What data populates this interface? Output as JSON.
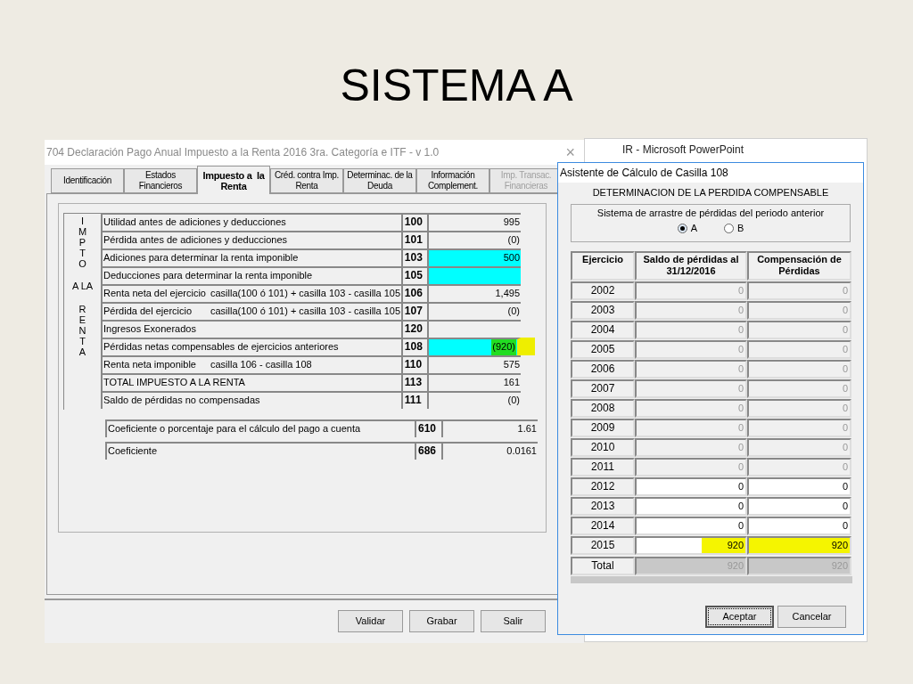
{
  "slide": {
    "title": "SISTEMA A"
  },
  "background_window": {
    "title": "IR - Microsoft PowerPoint"
  },
  "main_window": {
    "title": "704 Declaración Pago Anual Impuesto a la Renta 2016 3ra. Categoría e ITF - v 1.0",
    "close": "×",
    "tabs": [
      {
        "label": "Identificación",
        "selected": false,
        "disabled": false
      },
      {
        "label": "Estados\nFinancieros",
        "selected": false,
        "disabled": false
      },
      {
        "label": "Impuesto a  la\nRenta",
        "selected": true,
        "disabled": false
      },
      {
        "label": "Créd. contra Imp.\nRenta",
        "selected": false,
        "disabled": false
      },
      {
        "label": "Determinac. de la\nDeuda",
        "selected": false,
        "disabled": false
      },
      {
        "label": "Información\nComplement.",
        "selected": false,
        "disabled": false
      },
      {
        "label": "Imp. Transac.\nFinancieras",
        "selected": false,
        "disabled": true
      }
    ],
    "side_label": [
      "IMPTO",
      "A LA",
      "RENTA"
    ],
    "rows": [
      {
        "label": "Utilidad antes de adiciones y deducciones",
        "code": "100",
        "value": "995",
        "kind": "calc",
        "highlighted": false
      },
      {
        "label": "Pérdida antes de adiciones y deducciones",
        "code": "101",
        "value": "(0)",
        "kind": "calc",
        "highlighted": false
      },
      {
        "label": "Adiciones para determinar la renta imponible",
        "code": "103",
        "value": "500",
        "kind": "input",
        "highlighted": false
      },
      {
        "label": "Deducciones para determinar la renta imponible",
        "code": "105",
        "kind": "input",
        "highlighted": false
      },
      {
        "label": "Renta neta del ejercicio",
        "formula": "casilla(100 ó 101) + casilla 103 - casilla 105",
        "code": "106",
        "value": "1,495",
        "kind": "calc",
        "highlighted": false
      },
      {
        "label": "Pérdida del ejercicio",
        "formula": "casilla(100 ó 101) + casilla 103 - casilla 105",
        "code": "107",
        "value": "(0)",
        "kind": "calc",
        "highlighted": false
      },
      {
        "label": "Ingresos Exonerados",
        "code": "120",
        "kind": "calc",
        "highlighted": false
      },
      {
        "label": "Pérdidas netas compensables de ejercicios anteriores",
        "code": "108",
        "value": "(920)",
        "kind": "input",
        "highlighted": true
      },
      {
        "label": "Renta neta imponible",
        "formula": "casilla 106 - casilla 108",
        "code": "110",
        "value": "575",
        "kind": "calc",
        "highlighted": false
      },
      {
        "label": "TOTAL IMPUESTO A LA RENTA",
        "code": "113",
        "value": "161",
        "kind": "calc",
        "highlighted": false
      },
      {
        "label": "Saldo de pérdidas no compensadas",
        "code": "111",
        "value": "(0)",
        "kind": "calc",
        "highlighted": false
      }
    ],
    "extra_rows": [
      {
        "label": "Coeficiente o porcentaje para el cálculo del pago a cuenta",
        "code": "610",
        "value": "1.61"
      },
      {
        "label": "Coeficiente",
        "code": "686",
        "value": "0.0161"
      }
    ],
    "buttons": [
      "Validar",
      "Grabar",
      "Salir"
    ]
  },
  "dialog": {
    "title": "Asistente de Cálculo de Casilla 108",
    "heading": "DETERMINACION DE LA PERDIDA COMPENSABLE",
    "group_label": "Sistema de arrastre de pérdidas del periodo anterior",
    "options": [
      {
        "label": "A",
        "selected": true
      },
      {
        "label": "B",
        "selected": false
      }
    ],
    "columns": [
      "Ejercicio",
      "Saldo de pérdidas  al\n31/12/2016",
      "Compensación de\nPérdidas"
    ],
    "rows": [
      {
        "year": "2002",
        "balance": "0",
        "compensation": "0",
        "editable": false,
        "highlighted": false
      },
      {
        "year": "2003",
        "balance": "0",
        "compensation": "0",
        "editable": false,
        "highlighted": false
      },
      {
        "year": "2004",
        "balance": "0",
        "compensation": "0",
        "editable": false,
        "highlighted": false
      },
      {
        "year": "2005",
        "balance": "0",
        "compensation": "0",
        "editable": false,
        "highlighted": false
      },
      {
        "year": "2006",
        "balance": "0",
        "compensation": "0",
        "editable": false,
        "highlighted": false
      },
      {
        "year": "2007",
        "balance": "0",
        "compensation": "0",
        "editable": false,
        "highlighted": false
      },
      {
        "year": "2008",
        "balance": "0",
        "compensation": "0",
        "editable": false,
        "highlighted": false
      },
      {
        "year": "2009",
        "balance": "0",
        "compensation": "0",
        "editable": false,
        "highlighted": false
      },
      {
        "year": "2010",
        "balance": "0",
        "compensation": "0",
        "editable": false,
        "highlighted": false
      },
      {
        "year": "2011",
        "balance": "0",
        "compensation": "0",
        "editable": false,
        "highlighted": false
      },
      {
        "year": "2012",
        "balance": "0",
        "compensation": "0",
        "editable": true,
        "highlighted": false
      },
      {
        "year": "2013",
        "balance": "0",
        "compensation": "0",
        "editable": true,
        "highlighted": false
      },
      {
        "year": "2014",
        "balance": "0",
        "compensation": "0",
        "editable": true,
        "highlighted": false
      },
      {
        "year": "2015",
        "balance": "920",
        "compensation": "920",
        "editable": true,
        "highlighted": true
      }
    ],
    "total": {
      "label": "Total",
      "balance": "920",
      "compensation": "920"
    },
    "buttons": [
      "Aceptar",
      "Cancelar"
    ]
  }
}
